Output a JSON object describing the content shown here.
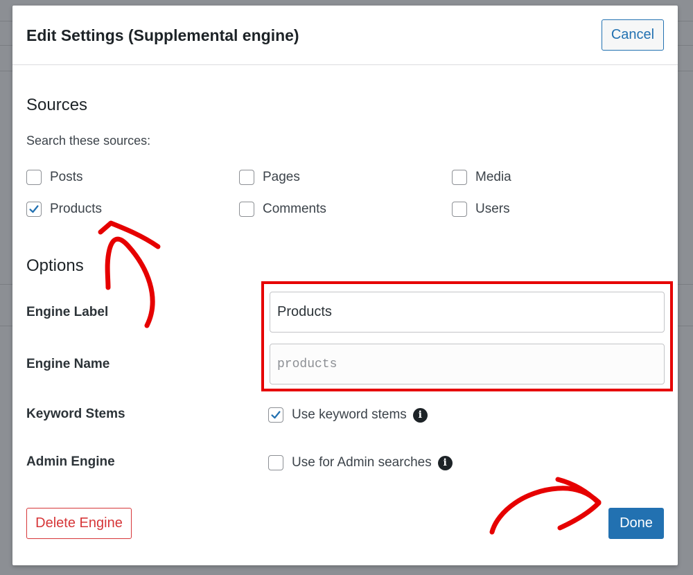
{
  "modal": {
    "title": "Edit Settings (Supplemental engine)",
    "cancel_label": "Cancel"
  },
  "sources": {
    "heading": "Sources",
    "helper": "Search these sources:",
    "items": [
      {
        "label": "Posts",
        "checked": false
      },
      {
        "label": "Pages",
        "checked": false
      },
      {
        "label": "Media",
        "checked": false
      },
      {
        "label": "Products",
        "checked": true
      },
      {
        "label": "Comments",
        "checked": false
      },
      {
        "label": "Users",
        "checked": false
      }
    ]
  },
  "options": {
    "heading": "Options",
    "engine_label": {
      "label": "Engine Label",
      "value": "Products"
    },
    "engine_name": {
      "label": "Engine Name",
      "value": "products"
    },
    "keyword_stems": {
      "label": "Keyword Stems",
      "option_label": "Use keyword stems",
      "checked": true
    },
    "admin_engine": {
      "label": "Admin Engine",
      "option_label": "Use for Admin searches",
      "checked": false
    }
  },
  "footer": {
    "delete_label": "Delete Engine",
    "done_label": "Done"
  },
  "colors": {
    "accent": "#2271b1",
    "danger": "#d63638",
    "annotation": "#e60000"
  },
  "icons": {
    "check": "checkmark-icon",
    "info": "info-icon"
  }
}
